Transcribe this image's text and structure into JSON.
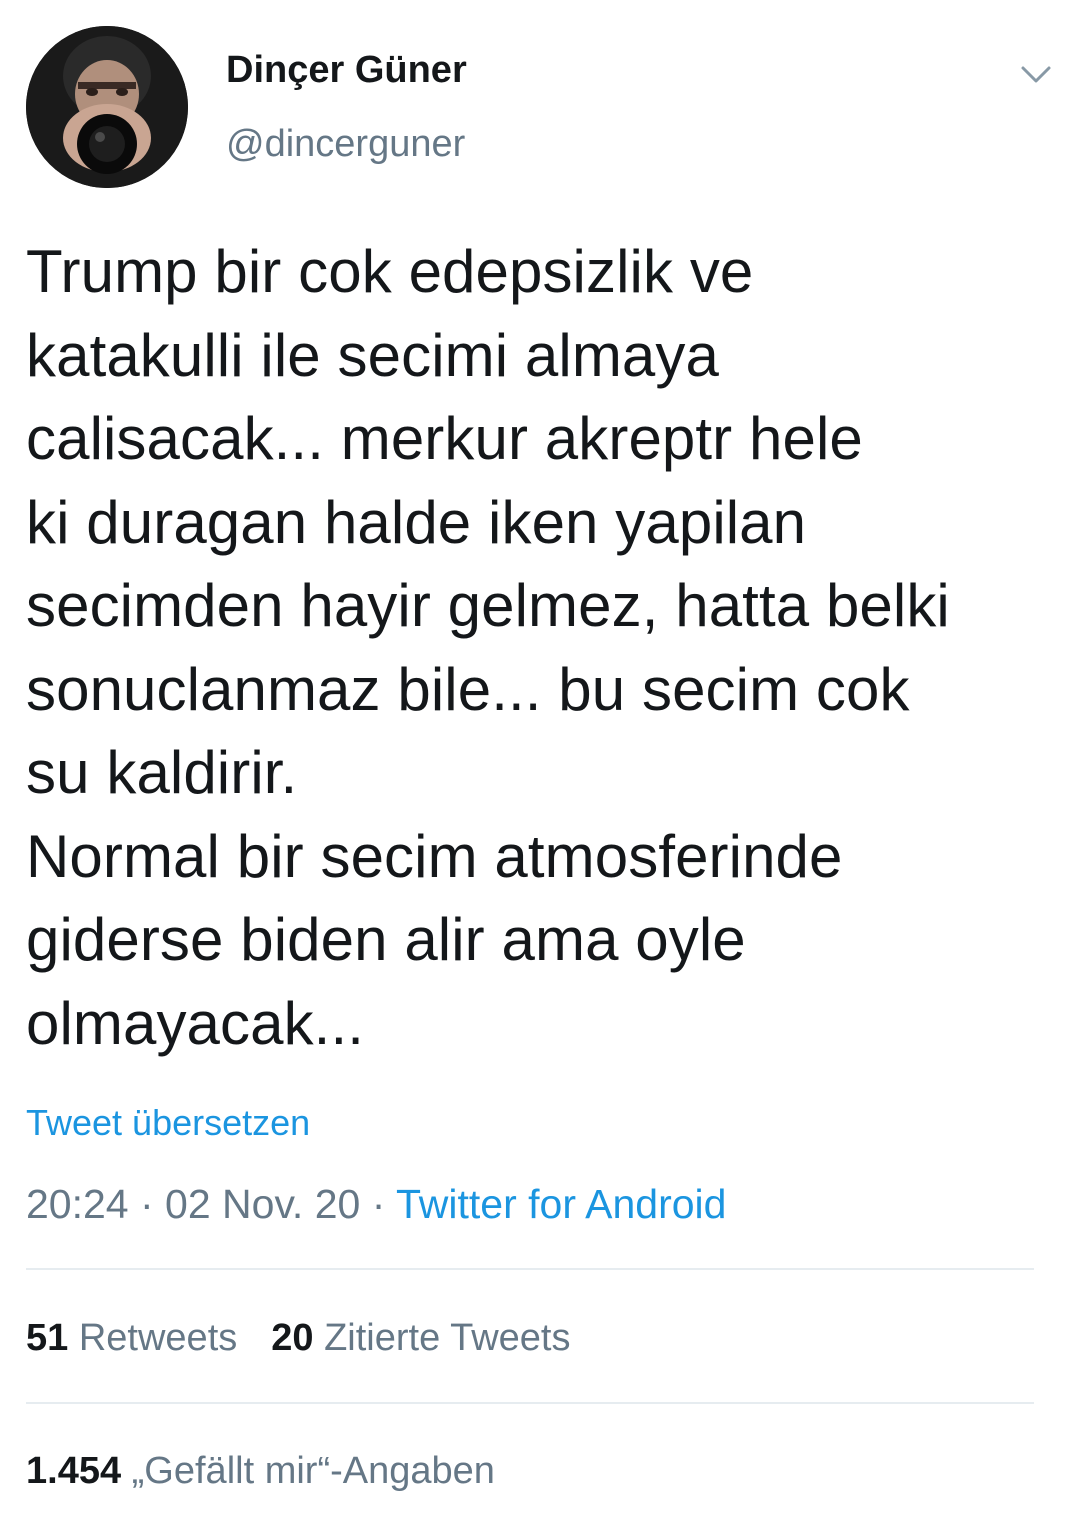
{
  "author": {
    "display_name": "Dinçer Güner",
    "handle": "@dincerguner"
  },
  "tweet": {
    "text": "Trump bir cok edepsizlik ve\nkatakulli ile secimi almaya\ncalisacak... merkur akreptr hele\nki duragan halde iken yapilan\nsecimden hayir gelmez, hatta belki\nsonuclanmaz bile... bu secim cok\nsu kaldirir.\nNormal bir secim atmosferinde\ngiderse biden alir ama oyle\nolmayacak...",
    "translate_label": "Tweet übersetzen"
  },
  "meta": {
    "time": "20:24",
    "separator": " · ",
    "date": "02 Nov. 20",
    "source": "Twitter for Android"
  },
  "stats": {
    "retweets_count": "51",
    "retweets_label": "Retweets",
    "quotes_count": "20",
    "quotes_label": "Zitierte Tweets",
    "likes_count": "1.454",
    "likes_label": "„Gefällt mir“-Angaben"
  },
  "icons": {
    "menu": "chevron-down-icon"
  },
  "colors": {
    "text": "#14171a",
    "secondary": "#657786",
    "link": "#1b95e0",
    "divider": "#e6ecf0"
  }
}
